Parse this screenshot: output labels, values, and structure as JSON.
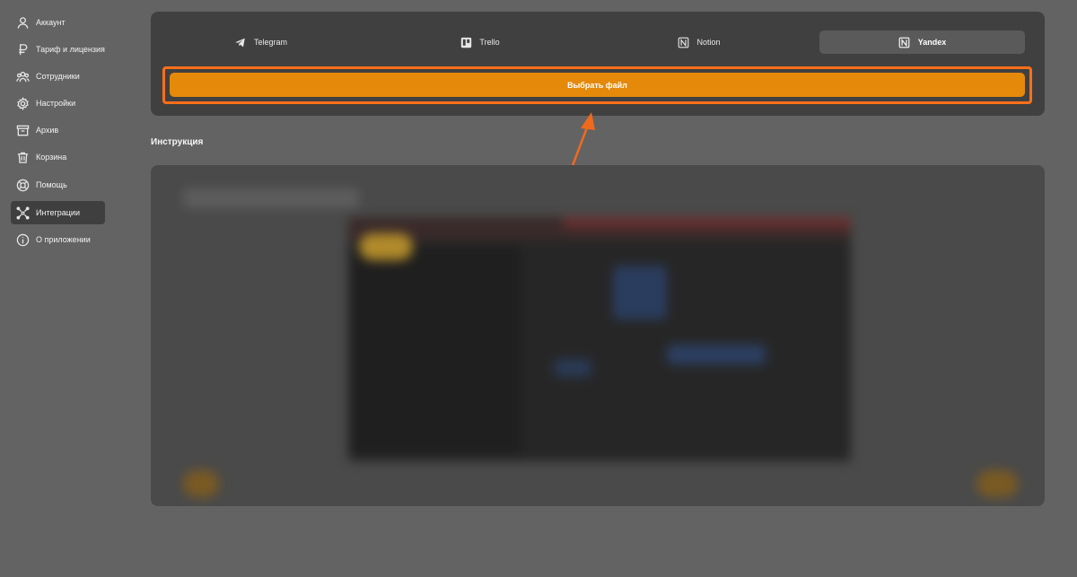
{
  "sidebar": {
    "items": [
      {
        "label": "Аккаунт",
        "icon": "user-icon"
      },
      {
        "label": "Тариф и лицензия",
        "icon": "ruble-icon"
      },
      {
        "label": "Сотрудники",
        "icon": "users-icon"
      },
      {
        "label": "Настройки",
        "icon": "gear-icon"
      },
      {
        "label": "Архив",
        "icon": "archive-icon"
      },
      {
        "label": "Корзина",
        "icon": "trash-icon"
      },
      {
        "label": "Помощь",
        "icon": "lifebuoy-icon"
      },
      {
        "label": "Интеграции",
        "icon": "integrations-icon",
        "active": true
      },
      {
        "label": "О приложении",
        "icon": "info-icon"
      }
    ]
  },
  "tabs": [
    {
      "label": "Telegram",
      "icon": "telegram-icon"
    },
    {
      "label": "Trello",
      "icon": "trello-icon"
    },
    {
      "label": "Notion",
      "icon": "notion-icon"
    },
    {
      "label": "Yandex",
      "icon": "notion-icon",
      "active": true
    }
  ],
  "choose_file_label": "Выбрать файл",
  "instruction_title": "Инструкция",
  "colors": {
    "accent": "#e5890a",
    "highlight": "#ff6f1a",
    "background": "#636363",
    "panel": "#404040"
  }
}
